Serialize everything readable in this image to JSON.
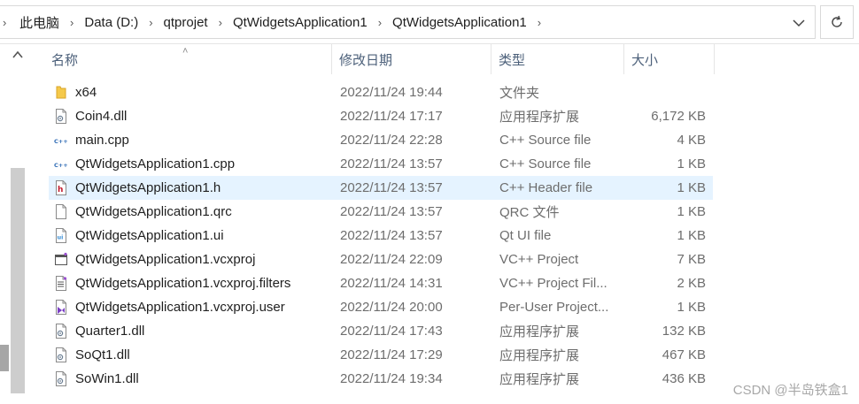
{
  "breadcrumb": {
    "items": [
      "此电脑",
      "Data (D:)",
      "qtprojet",
      "QtWidgetsApplication1",
      "QtWidgetsApplication1"
    ]
  },
  "columns": {
    "name": "名称",
    "date": "修改日期",
    "type": "类型",
    "size": "大小"
  },
  "files": [
    {
      "name": "x64",
      "date": "2022/11/24 19:44",
      "type": "文件夹",
      "size": "",
      "icon": "folder-icon"
    },
    {
      "name": "Coin4.dll",
      "date": "2022/11/24 17:17",
      "type": "应用程序扩展",
      "size": "6,172 KB",
      "icon": "dll-file-icon"
    },
    {
      "name": "main.cpp",
      "date": "2022/11/24 22:28",
      "type": "C++ Source file",
      "size": "4 KB",
      "icon": "cpp-file-icon"
    },
    {
      "name": "QtWidgetsApplication1.cpp",
      "date": "2022/11/24 13:57",
      "type": "C++ Source file",
      "size": "1 KB",
      "icon": "cpp-file-icon"
    },
    {
      "name": "QtWidgetsApplication1.h",
      "date": "2022/11/24 13:57",
      "type": "C++ Header file",
      "size": "1 KB",
      "icon": "header-file-icon",
      "selected": true
    },
    {
      "name": "QtWidgetsApplication1.qrc",
      "date": "2022/11/24 13:57",
      "type": "QRC 文件",
      "size": "1 KB",
      "icon": "blank-file-icon"
    },
    {
      "name": "QtWidgetsApplication1.ui",
      "date": "2022/11/24 13:57",
      "type": "Qt UI file",
      "size": "1 KB",
      "icon": "ui-file-icon"
    },
    {
      "name": "QtWidgetsApplication1.vcxproj",
      "date": "2022/11/24 22:09",
      "type": "VC++ Project",
      "size": "7 KB",
      "icon": "vcxproj-file-icon"
    },
    {
      "name": "QtWidgetsApplication1.vcxproj.filters",
      "date": "2022/11/24 14:31",
      "type": "VC++ Project Fil...",
      "size": "2 KB",
      "icon": "filters-file-icon"
    },
    {
      "name": "QtWidgetsApplication1.vcxproj.user",
      "date": "2022/11/24 20:00",
      "type": "Per-User Project...",
      "size": "1 KB",
      "icon": "vs-user-file-icon"
    },
    {
      "name": "Quarter1.dll",
      "date": "2022/11/24 17:43",
      "type": "应用程序扩展",
      "size": "132 KB",
      "icon": "dll-file-icon"
    },
    {
      "name": "SoQt1.dll",
      "date": "2022/11/24 17:29",
      "type": "应用程序扩展",
      "size": "467 KB",
      "icon": "dll-file-icon"
    },
    {
      "name": "SoWin1.dll",
      "date": "2022/11/24 19:34",
      "type": "应用程序扩展",
      "size": "436 KB",
      "icon": "dll-file-icon"
    }
  ],
  "watermark": "CSDN @半岛铁盒1",
  "colors": {
    "selected_row": "#e5f3ff",
    "header_text": "#4c607a",
    "folder": "#f5c94a"
  }
}
